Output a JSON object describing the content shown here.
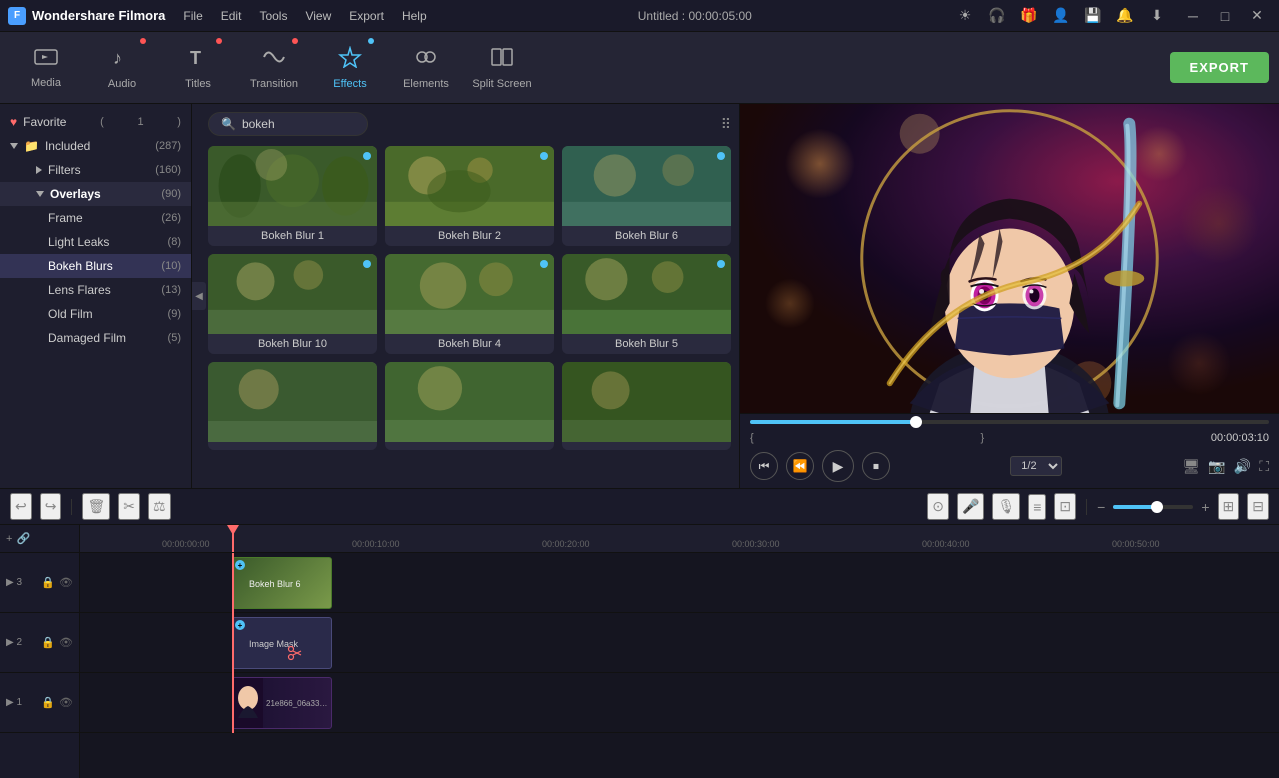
{
  "app": {
    "name": "Wondershare Filmora",
    "title": "Untitled : 00:00:05:00"
  },
  "menu": {
    "items": [
      "File",
      "Edit",
      "Tools",
      "View",
      "Export",
      "Help"
    ]
  },
  "titlebar": {
    "controls": [
      "minimize",
      "maximize",
      "close"
    ]
  },
  "toolbar": {
    "items": [
      {
        "id": "media",
        "label": "Media",
        "icon": "🎬",
        "dot": false
      },
      {
        "id": "audio",
        "label": "Audio",
        "icon": "🎵",
        "dot": true,
        "dot_color": "red"
      },
      {
        "id": "titles",
        "label": "Titles",
        "icon": "T",
        "dot": true,
        "dot_color": "red"
      },
      {
        "id": "transition",
        "label": "Transition",
        "icon": "⬡",
        "dot": true,
        "dot_color": "red"
      },
      {
        "id": "effects",
        "label": "Effects",
        "icon": "✦",
        "dot": true,
        "dot_color": "blue",
        "active": true
      },
      {
        "id": "elements",
        "label": "Elements",
        "icon": "◈",
        "dot": false
      },
      {
        "id": "splitscreen",
        "label": "Split Screen",
        "icon": "⊞",
        "dot": false
      }
    ],
    "export_label": "EXPORT"
  },
  "sidebar": {
    "favorite": {
      "label": "Favorite",
      "count": 1
    },
    "included": {
      "label": "Included",
      "count": 287
    },
    "filters": {
      "label": "Filters",
      "count": 160
    },
    "overlays": {
      "label": "Overlays",
      "count": 90,
      "active": true
    },
    "overlay_items": [
      {
        "label": "Frame",
        "count": 26
      },
      {
        "label": "Light Leaks",
        "count": 8
      },
      {
        "label": "Bokeh Blurs",
        "count": 10,
        "active": true
      },
      {
        "label": "Lens Flares",
        "count": 13
      },
      {
        "label": "Old Film",
        "count": 9
      },
      {
        "label": "Damaged Film",
        "count": 5
      }
    ]
  },
  "search": {
    "placeholder": "bokeh",
    "value": "bokeh"
  },
  "effects": {
    "items": [
      {
        "label": "Bokeh Blur 1",
        "thumb": "thumb-1"
      },
      {
        "label": "Bokeh Blur 2",
        "thumb": "thumb-2"
      },
      {
        "label": "Bokeh Blur 6",
        "thumb": "thumb-3"
      },
      {
        "label": "Bokeh Blur 10",
        "thumb": "thumb-4"
      },
      {
        "label": "Bokeh Blur 4",
        "thumb": "thumb-5"
      },
      {
        "label": "Bokeh Blur 5",
        "thumb": "thumb-6"
      },
      {
        "label": "",
        "thumb": "thumb-7"
      },
      {
        "label": "",
        "thumb": "thumb-8"
      },
      {
        "label": "",
        "thumb": "thumb-9"
      }
    ]
  },
  "preview": {
    "time_current": "00:00:03:10",
    "time_bracket_start": "{",
    "time_bracket_end": "}",
    "progress_percent": 32,
    "quality": "1/2",
    "controls": {
      "rewind": "⏮",
      "step_back": "⏪",
      "play": "▶",
      "stop": "⏹",
      "step_forward": "⏩"
    }
  },
  "timeline": {
    "timestamps": [
      "00:00:00:00",
      "00:00:10:00",
      "00:00:20:00",
      "00:00:30:00",
      "00:00:40:00",
      "00:00:50:00"
    ],
    "tracks": [
      {
        "id": 3,
        "label": "3",
        "clip_label": "Bokeh Blur 6",
        "type": "overlay"
      },
      {
        "id": 2,
        "label": "2",
        "clip_label": "Image Mask",
        "type": "mask"
      },
      {
        "id": 1,
        "label": "1",
        "clip_label": "21e866_06a338...",
        "type": "video"
      }
    ],
    "zoom": {
      "minus_label": "−",
      "plus_label": "+"
    }
  }
}
